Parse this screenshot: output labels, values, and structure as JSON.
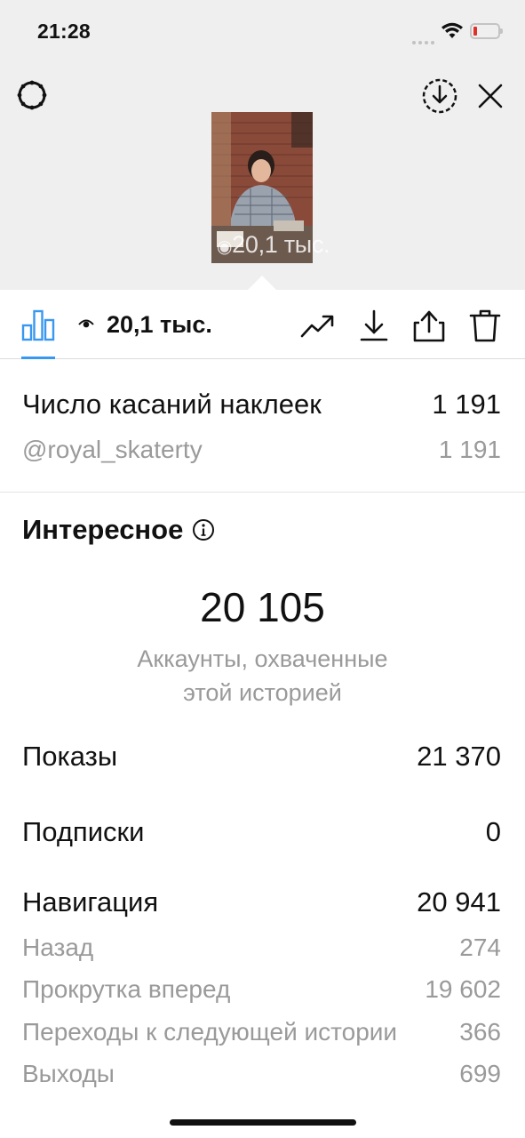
{
  "status_bar": {
    "time": "21:28",
    "icons": [
      "signal-dots-icon",
      "wifi-icon",
      "battery-low-icon"
    ],
    "battery_color": "#e0302a"
  },
  "header": {
    "icons": [
      "settings-gear-icon",
      "download-circle-icon",
      "close-icon"
    ],
    "thumbnail_views": "20,1 тыс."
  },
  "toolbar": {
    "views": "20,1 тыс.",
    "icons": [
      "bar-chart-icon",
      "eye-icon",
      "trending-up-icon",
      "download-icon",
      "share-icon",
      "trash-icon"
    ],
    "accent": "#3897f0"
  },
  "sticker_taps": {
    "label": "Число касаний наклеек",
    "value": "1 191",
    "sub": {
      "label": "@royal_skaterty",
      "value": "1 191"
    }
  },
  "discovery": {
    "title": "Интересное",
    "reach_value": "20 105",
    "reach_caption_line1": "Аккаунты, охваченные",
    "reach_caption_line2": "этой историей",
    "rows": [
      {
        "label": "Показы",
        "value": "21 370"
      },
      {
        "label": "Подписки",
        "value": "0"
      }
    ],
    "navigation": {
      "label": "Навигация",
      "value": "20 941",
      "sub": [
        {
          "label": "Назад",
          "value": "274"
        },
        {
          "label": "Прокрутка вперед",
          "value": "19 602"
        },
        {
          "label": "Переходы к следующей истории",
          "value": "366"
        },
        {
          "label": "Выходы",
          "value": "699"
        }
      ]
    }
  }
}
